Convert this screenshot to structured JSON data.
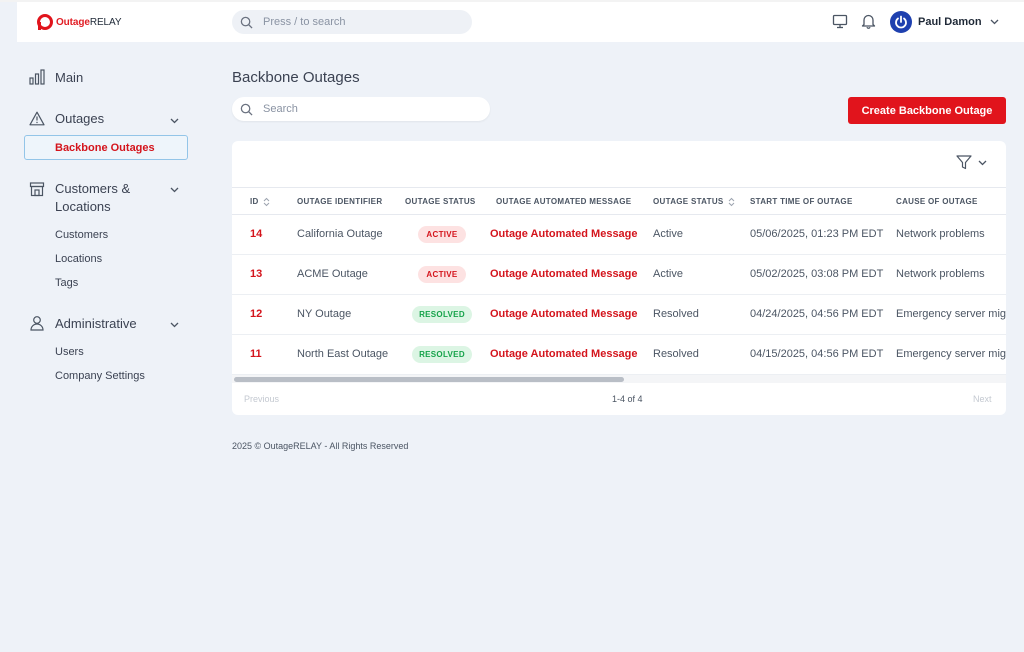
{
  "brand": {
    "prefix": "Outage",
    "suffix": "RELAY",
    "accent": "#e1141c"
  },
  "topbar": {
    "search_placeholder": "Press / to search",
    "icons": [
      "monitor-icon",
      "bell-icon"
    ],
    "user_name": "Paul Damon"
  },
  "sidebar": {
    "main": "Main",
    "outages": "Outages",
    "backbone_outages": "Backbone Outages",
    "customers_locations_line1": "Customers &",
    "customers_locations_line2": "Locations",
    "customers": "Customers",
    "locations": "Locations",
    "tags": "Tags",
    "administrative": "Administrative",
    "users": "Users",
    "company_settings": "Company Settings"
  },
  "page": {
    "title": "Backbone Outages",
    "search_placeholder": "Search",
    "create_button": "Create Backbone Outage"
  },
  "table": {
    "columns": [
      "ID",
      "OUTAGE IDENTIFIER",
      "OUTAGE STATUS",
      "OUTAGE AUTOMATED MESSAGE",
      "OUTAGE STATUS",
      "START TIME OF OUTAGE",
      "CAUSE OF OUTAGE"
    ],
    "rows": [
      {
        "id": "14",
        "identifier": "California Outage",
        "badge": "ACTIVE",
        "message": "Outage Automated Message",
        "status": "Active",
        "start": "05/06/2025, 01:23 PM EDT",
        "cause": "Network problems"
      },
      {
        "id": "13",
        "identifier": "ACME Outage",
        "badge": "ACTIVE",
        "message": "Outage Automated Message",
        "status": "Active",
        "start": "05/02/2025, 03:08 PM EDT",
        "cause": "Network problems"
      },
      {
        "id": "12",
        "identifier": "NY Outage",
        "badge": "RESOLVED",
        "message": "Outage Automated Message",
        "status": "Resolved",
        "start": "04/24/2025, 04:56 PM EDT",
        "cause": "Emergency server mig"
      },
      {
        "id": "11",
        "identifier": "North East Outage",
        "badge": "RESOLVED",
        "message": "Outage Automated Message",
        "status": "Resolved",
        "start": "04/15/2025, 04:56 PM EDT",
        "cause": "Emergency server mig"
      }
    ]
  },
  "pagination": {
    "previous": "Previous",
    "count": "1-4 of 4",
    "next": "Next"
  },
  "footer": "2025 © OutageRELAY - All Rights Reserved"
}
